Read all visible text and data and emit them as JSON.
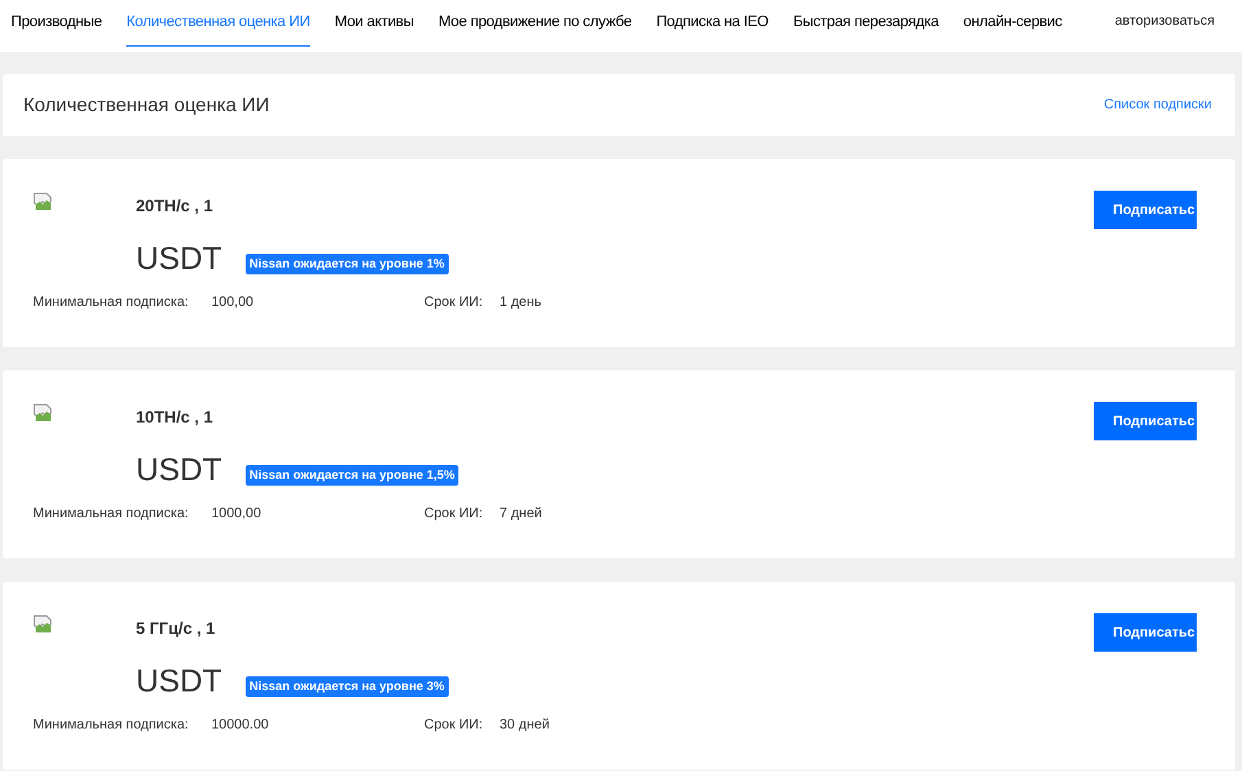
{
  "nav": {
    "tabs": [
      {
        "label": "Производные",
        "selected": false
      },
      {
        "label": "Количественная оценка ИИ",
        "selected": true
      },
      {
        "label": "Мои активы",
        "selected": false
      },
      {
        "label": "Мое продвижение по службе",
        "selected": false
      },
      {
        "label": "Подписка на IEO",
        "selected": false
      },
      {
        "label": "Быстрая перезарядка",
        "selected": false
      },
      {
        "label": "онлайн-сервис",
        "selected": false
      }
    ],
    "login": "авторизоваться"
  },
  "header": {
    "title": "Количественная оценка ИИ",
    "link": "Список подписки"
  },
  "products": [
    {
      "name": "20TH/c , 1",
      "currency": "USDT",
      "badge": "Nissan ожидается на уровне 1%",
      "min_label": "Минимальная подписка:",
      "min_value": "100,00",
      "term_label": "Срок ИИ:",
      "term_value": "1 день",
      "button": "Подписатьс"
    },
    {
      "name": "10TH/c , 1",
      "currency": "USDT",
      "badge": "Nissan ожидается на уровне 1,5%",
      "min_label": "Минимальная подписка:",
      "min_value": "1000,00",
      "term_label": "Срок ИИ:",
      "term_value": "7 дней",
      "button": "Подписатьс"
    },
    {
      "name": "5 ГГц/с , 1",
      "currency": "USDT",
      "badge": "Nissan ожидается на уровне 3%",
      "min_label": "Минимальная подписка:",
      "min_value": "10000.00",
      "term_label": "Срок ИИ:",
      "term_value": "30 дней",
      "button": "Подписатьс"
    }
  ]
}
